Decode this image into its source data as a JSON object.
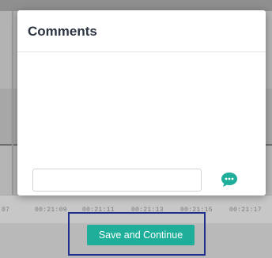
{
  "modal": {
    "title": "Comments",
    "comment_input": {
      "value": "",
      "placeholder": ""
    },
    "send_icon": "speech-bubble-ellipsis-icon"
  },
  "timeline": {
    "ticks": [
      "07",
      "00:21:09",
      "00:21:11",
      "00:21:13",
      "00:21:15",
      "00:21:17"
    ]
  },
  "footer": {
    "save_label": "Save and Continue"
  },
  "colors": {
    "accent": "#1fae9a",
    "highlight_border": "#1f2f8c",
    "overlay": "#b9b9b9"
  }
}
